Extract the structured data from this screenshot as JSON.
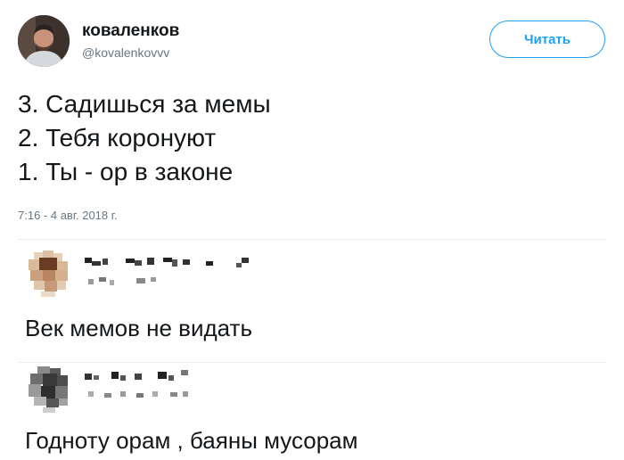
{
  "tweet": {
    "author_name": "коваленков",
    "author_handle": "@kovalenkovvv",
    "follow_label": "Читать",
    "lines": [
      "3. Садишься за мемы",
      "2. Тебя коронуют",
      "1. Ты - ор в законе"
    ],
    "timestamp": "7:16 - 4 авг. 2018 г."
  },
  "replies": [
    {
      "text": "Век мемов не видать"
    },
    {
      "text": "Годноту орам , баяны мусорам"
    }
  ],
  "colors": {
    "accent": "#1da1f2",
    "secondary_text": "#657786",
    "divider": "#e6ecf0"
  }
}
